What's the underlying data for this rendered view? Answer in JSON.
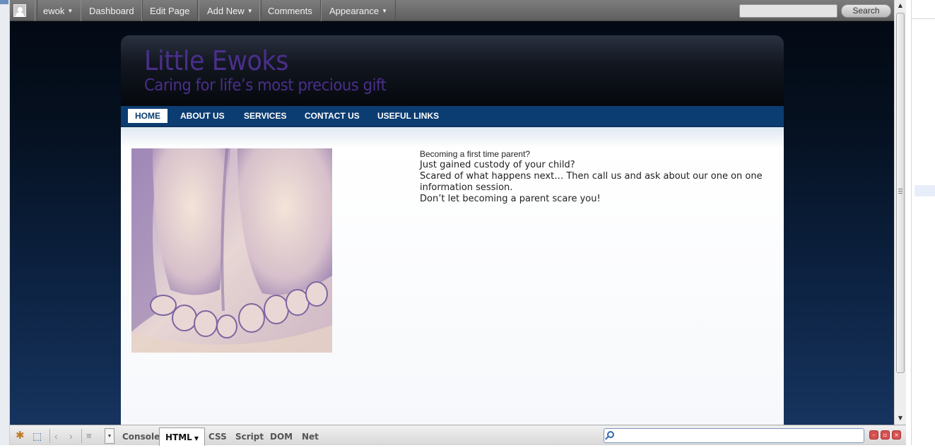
{
  "admin_bar": {
    "user": "ewok",
    "items": [
      "Dashboard",
      "Edit Page",
      "Add New",
      "Comments",
      "Appearance"
    ],
    "search_button": "Search"
  },
  "site": {
    "title": "Little Ewoks",
    "tagline": "Caring for life’s most precious gift"
  },
  "nav": {
    "items": [
      "HOME",
      "ABOUT US",
      "SERVICES",
      "CONTACT US",
      "USEFUL LINKS"
    ],
    "active": "HOME"
  },
  "content": {
    "line1": "Becoming a first time parent?",
    "line2": "Just gained custody of your child?",
    "line3": "Scared of what happens next… Then call us and ask about our one on one information session.",
    "line4": "Don’t let becoming a parent scare you!"
  },
  "devtools": {
    "tabs": [
      "Console",
      "HTML",
      "CSS",
      "Script",
      "DOM",
      "Net"
    ],
    "active_tab": "HTML"
  }
}
